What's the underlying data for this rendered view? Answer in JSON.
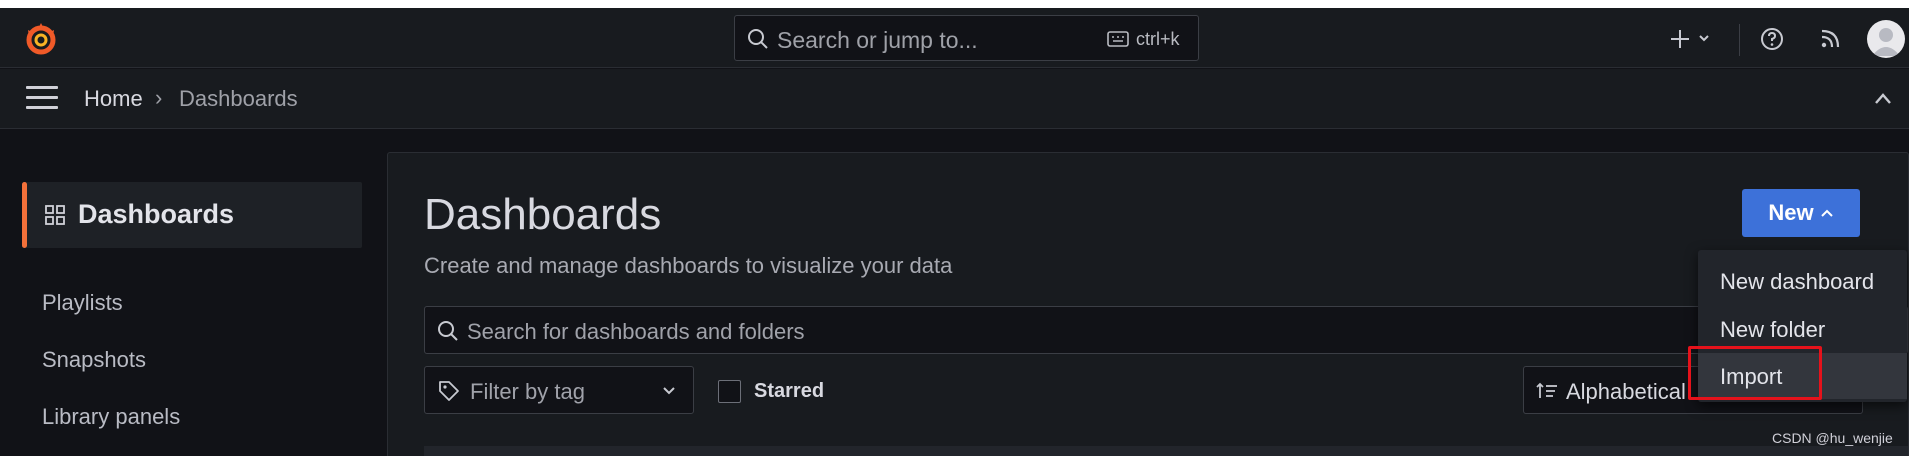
{
  "topbar": {
    "search_placeholder": "Search or jump to...",
    "search_shortcut": "ctrl+k"
  },
  "breadcrumb": {
    "home": "Home",
    "separator": "›",
    "current": "Dashboards"
  },
  "sidebar": {
    "active_label": "Dashboards",
    "items": [
      {
        "label": "Playlists"
      },
      {
        "label": "Snapshots"
      },
      {
        "label": "Library panels"
      }
    ]
  },
  "main": {
    "title": "Dashboards",
    "subtitle": "Create and manage dashboards to visualize your data",
    "new_button": "New",
    "search_placeholder": "Search for dashboards and folders",
    "tag_filter_placeholder": "Filter by tag",
    "starred_label": "Starred",
    "sort_value": "Alphabetical"
  },
  "new_menu": {
    "items": [
      {
        "label": "New dashboard"
      },
      {
        "label": "New folder"
      },
      {
        "label": "Import"
      }
    ]
  },
  "watermark": "CSDN @hu_wenjie",
  "colors": {
    "accent": "#3d71d9",
    "active_indicator": "#f4713a",
    "highlight_box": "#e5121b"
  }
}
